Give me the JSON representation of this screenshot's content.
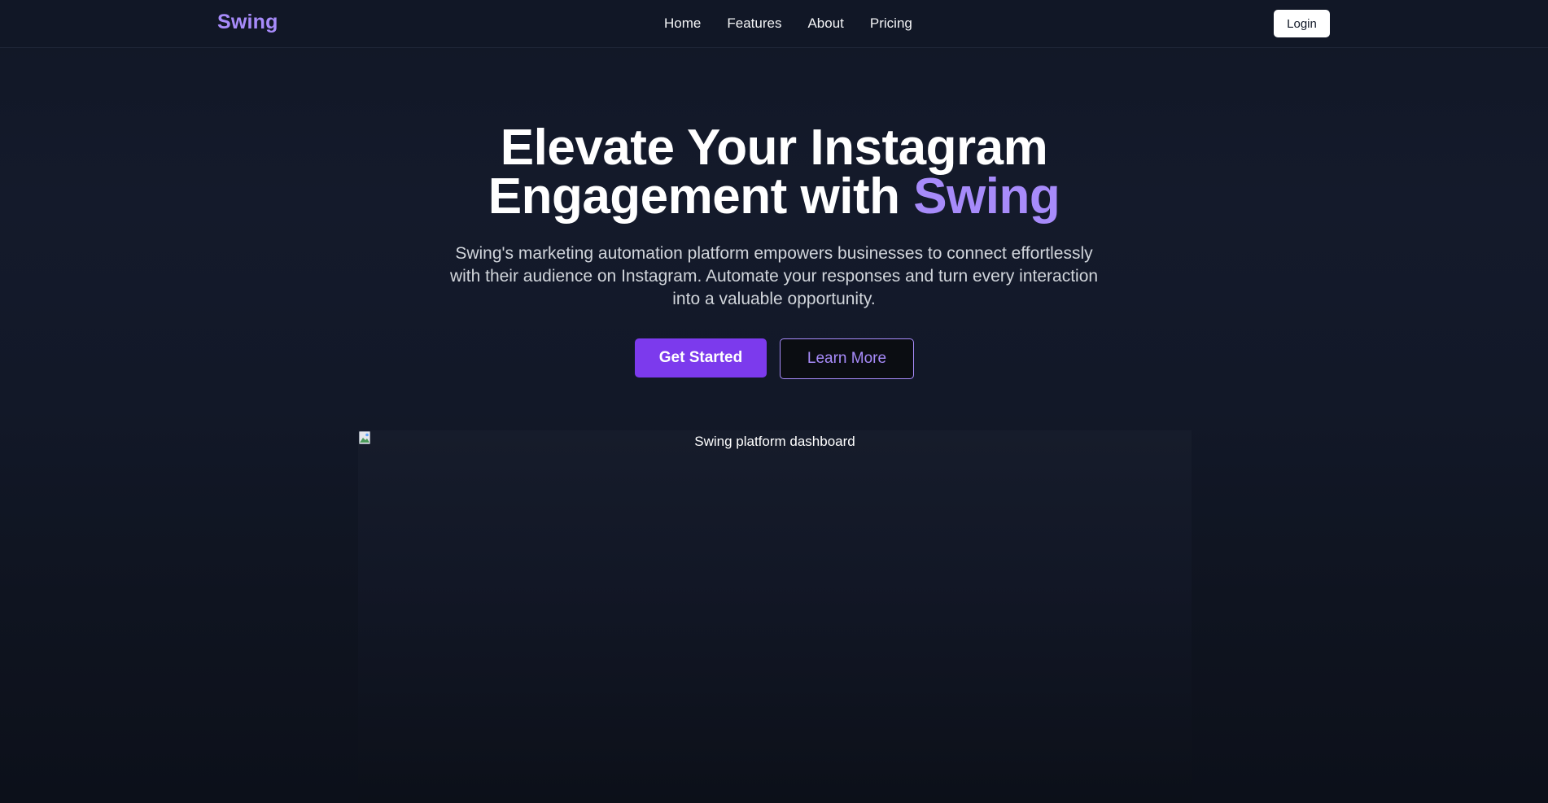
{
  "navbar": {
    "brand": "Swing",
    "links": [
      "Home",
      "Features",
      "About",
      "Pricing"
    ],
    "login_label": "Login"
  },
  "hero": {
    "title_line1": "Elevate Your Instagram",
    "title_line2_prefix": "Engagement with ",
    "title_accent": "Swing",
    "subtitle": "Swing's marketing automation platform empowers businesses to connect effortlessly with their audience on Instagram. Automate your responses and turn every interaction into a valuable opportunity.",
    "primary_cta": "Get Started",
    "secondary_cta": "Learn More"
  },
  "dashboard_image": {
    "alt": "Swing platform dashboard",
    "icon": "broken-image-icon"
  },
  "colors": {
    "background": "#121828",
    "accent": "#a78bfa",
    "primary_button": "#7c3aed",
    "text": "#ffffff",
    "muted_text": "#d1d5db"
  }
}
